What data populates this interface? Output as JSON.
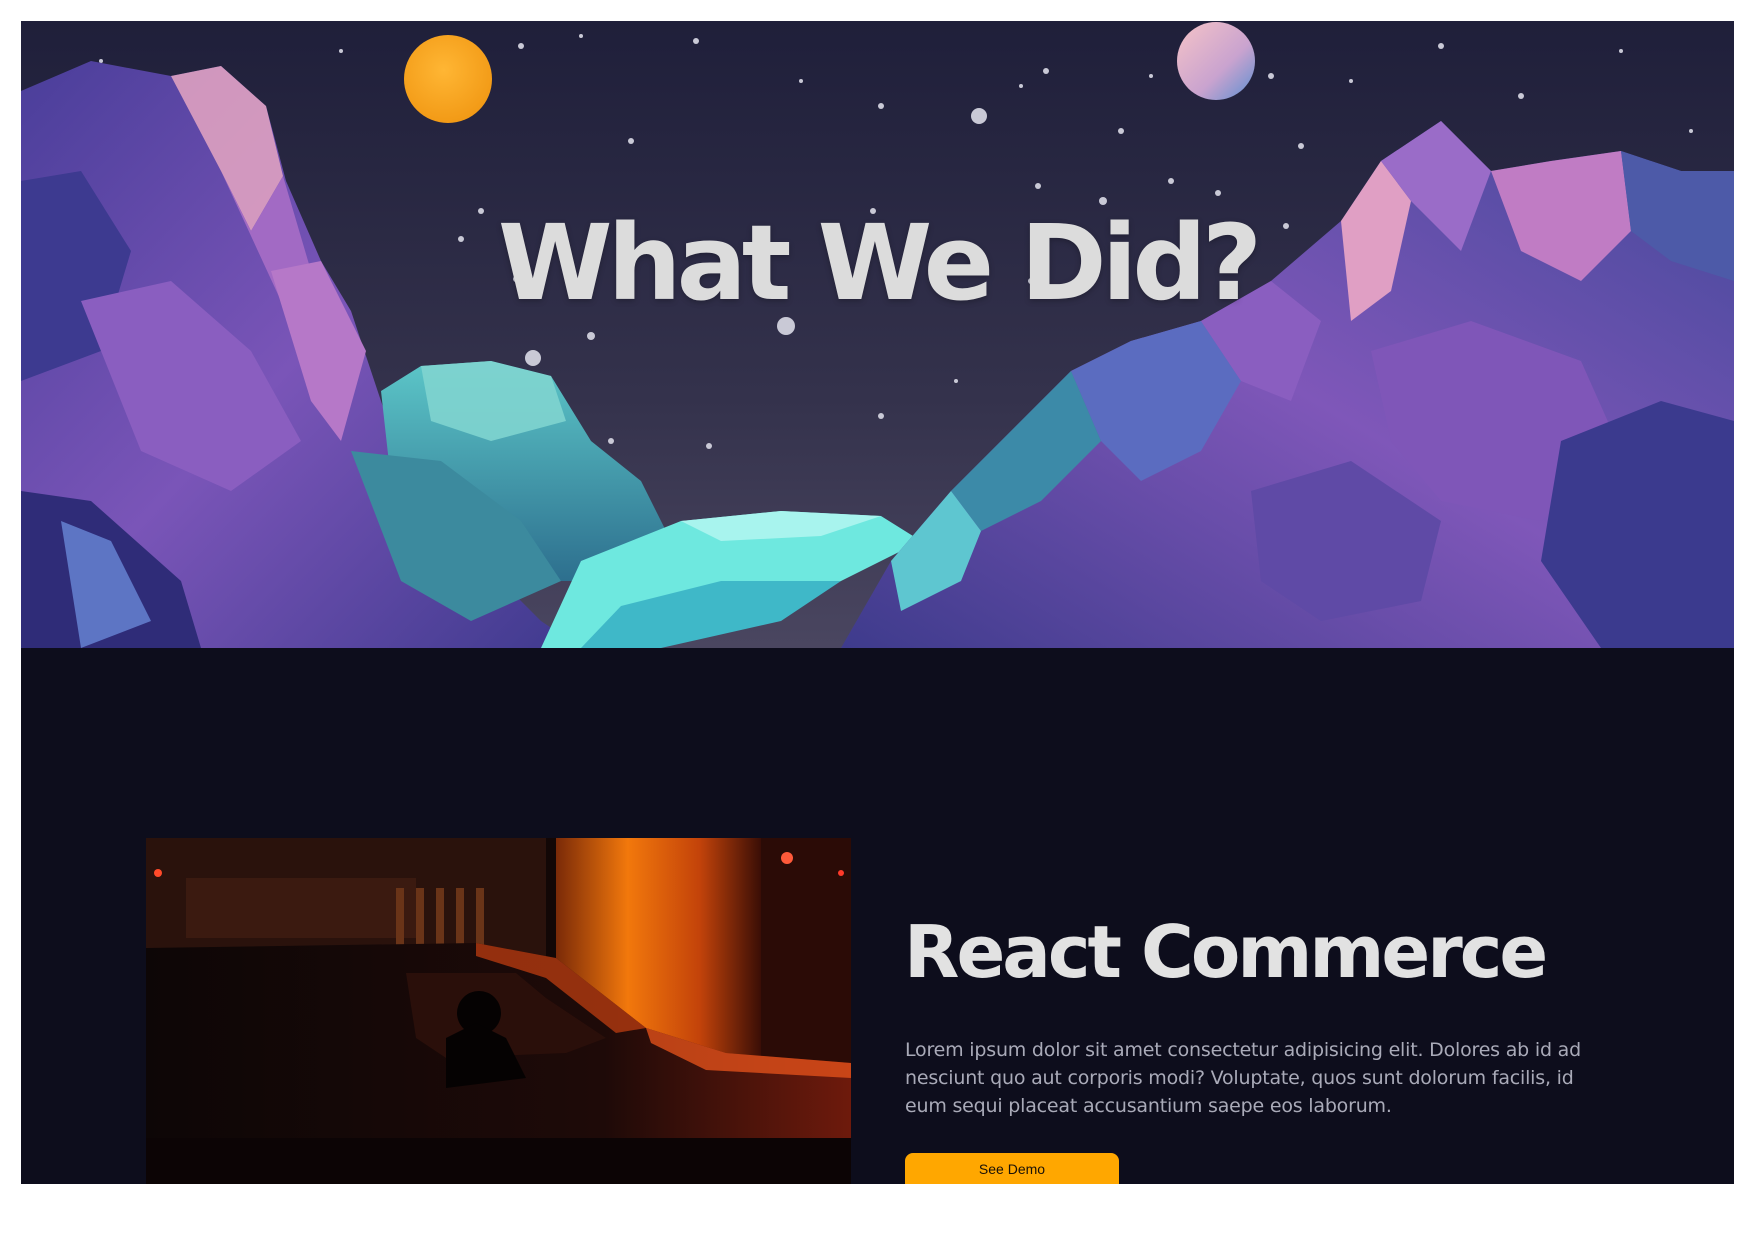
{
  "hero": {
    "title": "What We Did?",
    "colors": {
      "sky_top": "#1f1f3a",
      "sky_bottom": "#4a4660",
      "rock_purple": "#6a4aa8",
      "water": "#6ee8df",
      "sun": "#f7a823",
      "planet": "#f0b7c8"
    }
  },
  "project": {
    "title": "React Commerce",
    "description": "Lorem ipsum dolor sit amet consectetur adipisicing elit. Dolores ab id ad nesciunt quo aut corporis modi? Voluptate, quos sunt dolorum facilis, id eum sequi placeat accusantium saepe eos laborum.",
    "button_label": "See Demo",
    "accent_color": "#ffa700",
    "image": "night-car-photo"
  },
  "page": {
    "background": "#0d0d1c"
  }
}
